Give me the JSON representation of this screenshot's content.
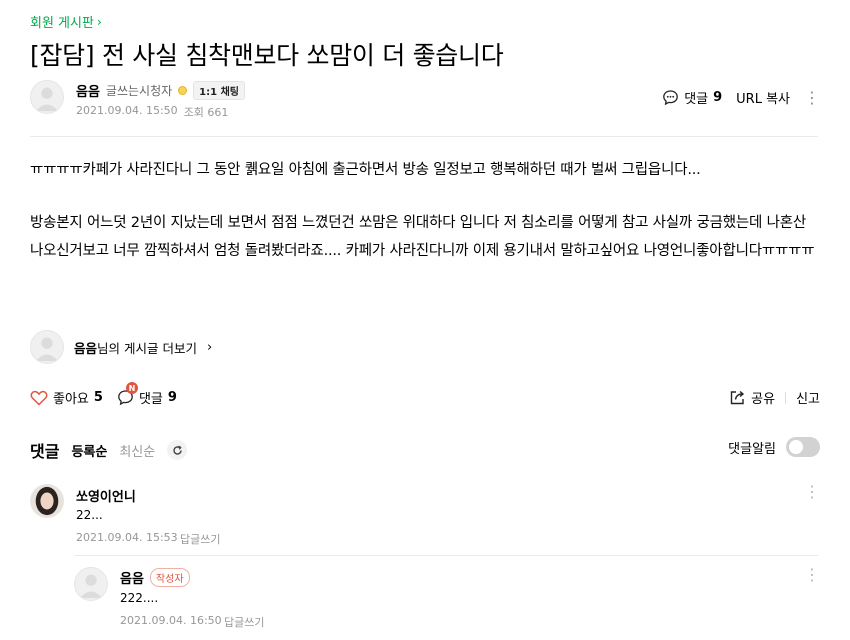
{
  "board": {
    "label": "회원 게시판",
    "chevron": "chevron-right-icon"
  },
  "post": {
    "title": "[잡담] 전 사실 침착맨보다 쏘맘이 더 좋습니다",
    "author": "음음",
    "grade": "글쓰는시청자",
    "chat_badge": "1:1 채팅",
    "date": "2021.09.04. 15:50",
    "views": "조회 661",
    "body": [
      "ㅠㅠㅠㅠ카페가 사라진다니 그 동안 퀡요일 아침에 출근하면서 방송 일정보고 행복해하던 때가 벌써 그립읍니다...",
      "방송본지 어느덧 2년이 지났는데 보면서 점점 느꼈던건 쏘맘은 위대하다 입니다 저 침소리를 어떻게 참고 사실까 궁금했는데 나혼산 나오신거보고 너무 깜찍하셔서 엄청 돌려봤더라죠.... 카페가 사라진다니까 이제 용기내서 말하고싶어요 나영언니좋아합니다ㅠㅠㅠㅠ"
    ]
  },
  "top_actions": {
    "comments_label": "댓글",
    "comments_count": "9",
    "url_copy": "URL 복사"
  },
  "author_more": {
    "name": "음음",
    "suffix": "님의 게시글 더보기"
  },
  "reactions": {
    "like_label": "좋아요",
    "like_count": "5",
    "new_badge": "N",
    "comment_label": "댓글",
    "comment_count": "9",
    "share": "공유",
    "report": "신고"
  },
  "comments_section": {
    "heading": "댓글",
    "sort_active": "등록순",
    "sort_latest": "최신순",
    "alarm_label": "댓글알림"
  },
  "comments": [
    {
      "name": "쏘영이언니",
      "text": "22...",
      "date": "2021.09.04. 15:53",
      "reply": "답글쓰기"
    },
    {
      "name": "음음",
      "badge": "작성자",
      "text": "222....",
      "date": "2021.09.04. 16:50",
      "reply": "답글쓰기"
    }
  ],
  "colors": {
    "brand_green": "#03a94e",
    "like_red": "#e0553d",
    "meta_gray": "#979797"
  }
}
